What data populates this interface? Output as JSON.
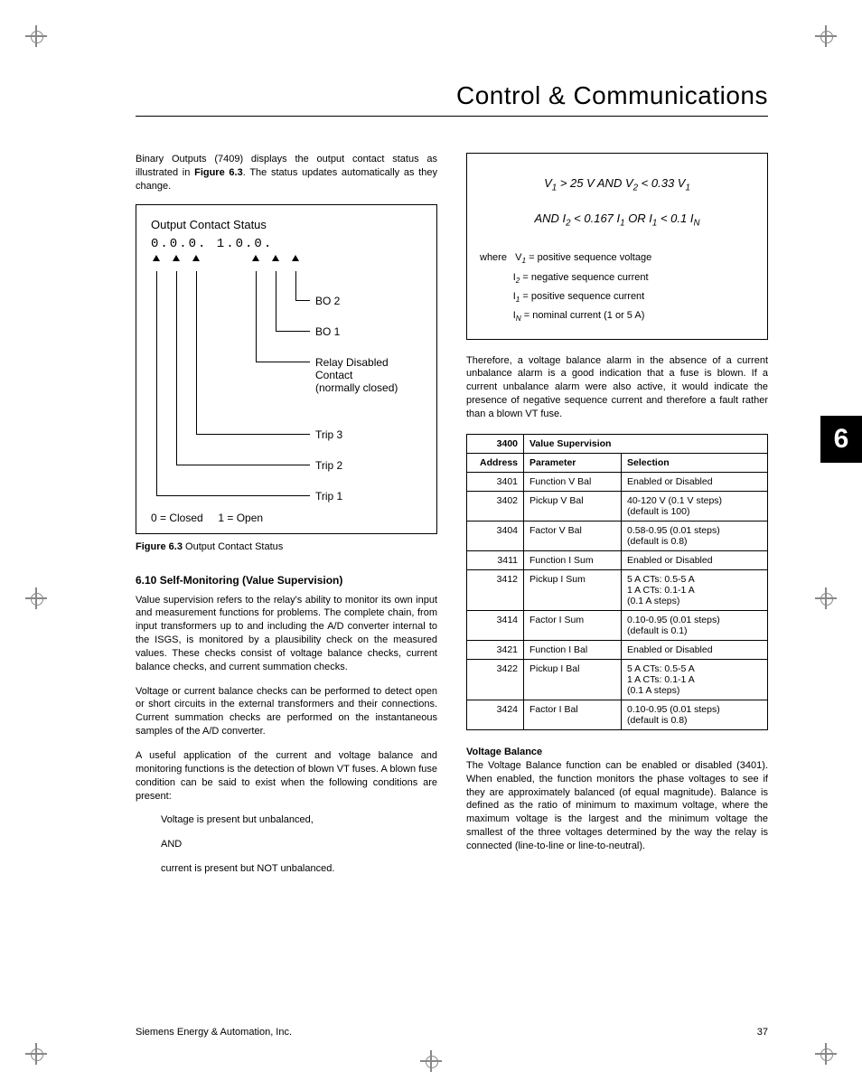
{
  "header": {
    "title": "Control & Communications"
  },
  "chapter_tab": "6",
  "left": {
    "intro": "Binary Outputs (7409) displays the output contact status as illustrated in ",
    "intro_fig_ref": "Figure 6.3",
    "intro_tail": ". The status updates automatically as they change.",
    "figure": {
      "title": "Output Contact Status",
      "lcd": "0.0.0.   1.0.0.",
      "labels": {
        "bo2": "BO 2",
        "bo1": "BO 1",
        "relay": "Relay Disabled\nContact\n(normally closed)",
        "trip3": "Trip 3",
        "trip2": "Trip 2",
        "trip1": "Trip 1"
      },
      "legend": "0 = Closed     1 = Open",
      "caption_label": "Figure 6.3",
      "caption_text": " Output Contact Status"
    },
    "section_heading": "6.10 Self-Monitoring (Value Supervision)",
    "p1": "Value supervision refers to the relay's ability to monitor its own input and measurement functions for problems. The complete chain, from input transformers up to and including the A/D converter internal to the ISGS, is monitored by a plausibility check on the measured values. These checks consist of voltage balance checks, current balance checks, and current summation checks.",
    "p2": "Voltage or current balance checks can be performed to detect open or short circuits in the external transformers and their connections. Current summation checks are performed on the instantaneous samples of the A/D converter.",
    "p3": "A useful application of the current and voltage balance and monitoring functions is the detection of blown VT fuses. A blown fuse condition can be said to exist when the following conditions are present:",
    "cond1": "Voltage is present but unbalanced,",
    "cond_and": "AND",
    "cond2": "current is present but NOT unbalanced."
  },
  "right": {
    "formula": {
      "line1_pre": "V",
      "line1": " > 25 V   AND   V",
      "line1_tail": " < 0.33 V",
      "line2_pre": "AND   I",
      "line2_mid": " < 0.167 I",
      "line2_or": "   OR   I",
      "line2_tail": " < 0.1 I",
      "where_label": "where",
      "w1": "V",
      "w1_txt": " = positive sequence voltage",
      "w2": "I",
      "w2_txt": " = negative sequence current",
      "w3": "I",
      "w3_txt": " = positive sequence current",
      "w4": "I",
      "w4_txt": " = nominal current (1 or 5 A)"
    },
    "para_after": "Therefore, a voltage balance alarm in the absence of a current unbalance alarm is a good indication that a fuse is blown. If a current unbalance alarm were also active, it would indicate the presence of negative sequence current and therefore a fault rather than a blown VT fuse.",
    "table": {
      "hdr_addr_group": "3400",
      "hdr_title": "Value Supervision",
      "col_addr": "Address",
      "col_param": "Parameter",
      "col_sel": "Selection",
      "rows": [
        {
          "a": "3401",
          "p": "Function V Bal",
          "s": "Enabled or Disabled"
        },
        {
          "a": "3402",
          "p": "Pickup V Bal",
          "s": "40-120 V  (0.1 V steps)\n(default is 100)"
        },
        {
          "a": "3404",
          "p": "Factor V Bal",
          "s": "0.58-0.95  (0.01 steps)\n(default is 0.8)"
        },
        {
          "a": "3411",
          "p": "Function I Sum",
          "s": "Enabled or Disabled"
        },
        {
          "a": "3412",
          "p": "Pickup I Sum",
          "s": "5 A CTs:  0.5-5 A\n1 A CTs:  0.1-1 A\n(0.1 A steps)"
        },
        {
          "a": "3414",
          "p": "Factor I Sum",
          "s": "0.10-0.95  (0.01 steps)\n(default is 0.1)"
        },
        {
          "a": "3421",
          "p": "Function I Bal",
          "s": "Enabled or Disabled"
        },
        {
          "a": "3422",
          "p": "Pickup I Bal",
          "s": "5 A CTs:  0.5-5 A\n1 A CTs:  0.1-1 A\n(0.1 A steps)"
        },
        {
          "a": "3424",
          "p": "Factor I Bal",
          "s": "0.10-0.95 (0.01 steps)\n(default is 0.8)"
        }
      ]
    },
    "sub_heading": "Voltage Balance",
    "sub_para": "The Voltage Balance function can be enabled or disabled (3401). When enabled, the function monitors the phase voltages to see if they are approximately balanced (of equal magnitude). Balance is defined as the ratio of minimum to maximum voltage, where the maximum voltage is the largest and the minimum voltage the smallest of the three voltages determined by the way the relay is connected (line-to-line or line-to-neutral)."
  },
  "footer": {
    "left": "Siemens Energy & Automation, Inc.",
    "right": "37"
  }
}
